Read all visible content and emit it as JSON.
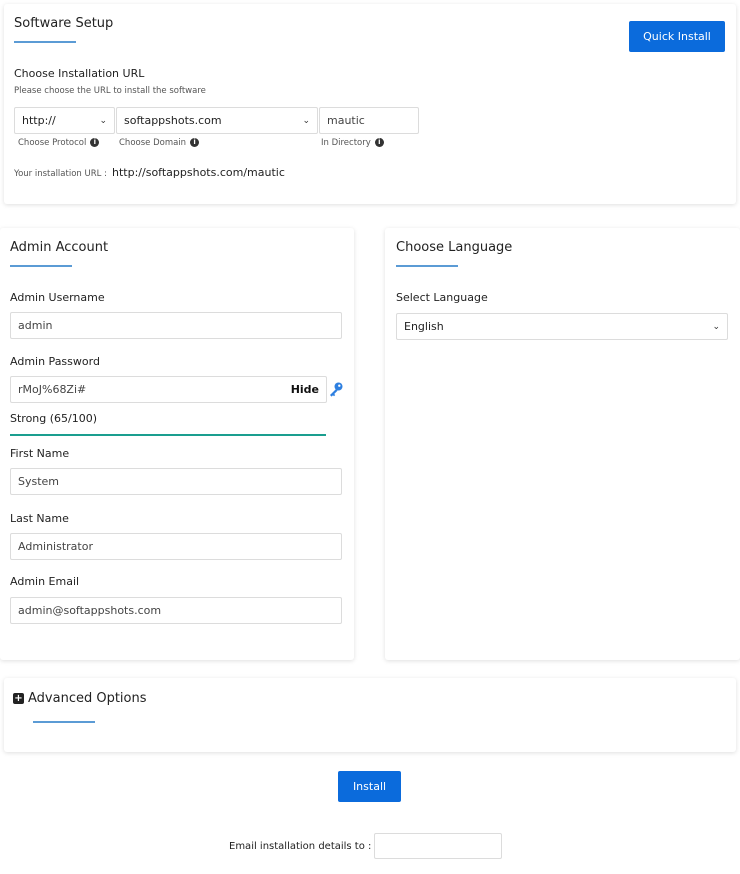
{
  "software_setup": {
    "title": "Software Setup",
    "quick_install_label": "Quick Install",
    "choose_url_label": "Choose Installation URL",
    "choose_url_hint": "Please choose the URL to install the software",
    "protocol_value": "http://",
    "domain_value": "softappshots.com",
    "directory_value": "mautic",
    "protocol_caption": "Choose Protocol",
    "domain_caption": "Choose Domain",
    "directory_caption": "In Directory",
    "install_url_label": "Your installation URL :",
    "install_url_value": "http://softappshots.com/mautic"
  },
  "admin_account": {
    "title": "Admin Account",
    "username_label": "Admin Username",
    "username_value": "admin",
    "password_label": "Admin Password",
    "password_value": "rMoJ%68Zi#",
    "hide_label": "Hide",
    "strength_label": "Strong (65/100)",
    "strength_fraction": 0.65,
    "first_name_label": "First Name",
    "first_name_value": "System",
    "last_name_label": "Last Name",
    "last_name_value": "Administrator",
    "email_label": "Admin Email",
    "email_value": "admin@softappshots.com"
  },
  "language": {
    "title": "Choose Language",
    "select_label": "Select Language",
    "selected_value": "English"
  },
  "advanced": {
    "toggle_icon": "plus-square-icon",
    "title": "Advanced Options"
  },
  "footer": {
    "install_label": "Install",
    "email_details_label": "Email installation details to :",
    "email_details_value": ""
  },
  "colors": {
    "accent": "#0b6bdc",
    "underline": "#5b9bd5",
    "strength_bar": "#1a9e8f"
  }
}
